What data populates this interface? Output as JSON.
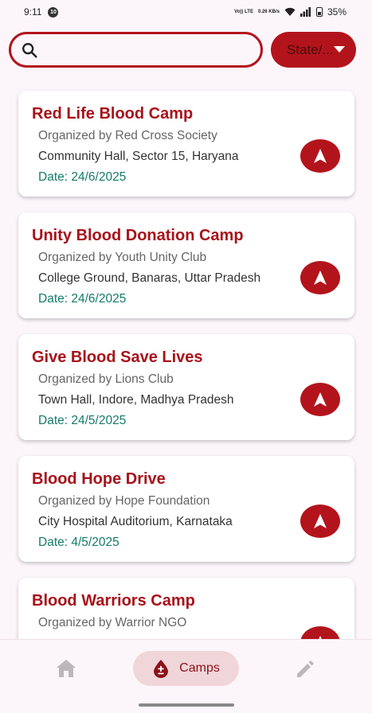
{
  "status": {
    "time": "9:11",
    "network": "Vo)) LTE",
    "speed": "0.26 KB/s",
    "battery": "35%"
  },
  "search": {
    "placeholder": "",
    "value": ""
  },
  "filter": {
    "label": "State/..."
  },
  "camps": [
    {
      "title": "Red Life Blood Camp",
      "organizer": "Organized by Red Cross Society",
      "location": "Community Hall, Sector 15, Haryana",
      "date": "Date: 24/6/2025"
    },
    {
      "title": "Unity Blood Donation Camp",
      "organizer": "Organized by Youth Unity Club",
      "location": "College Ground, Banaras, Uttar Pradesh",
      "date": "Date: 24/6/2025"
    },
    {
      "title": "Give Blood Save Lives",
      "organizer": "Organized by Lions Club",
      "location": "Town Hall, Indore, Madhya Pradesh",
      "date": "Date: 24/5/2025"
    },
    {
      "title": "Blood Hope Drive",
      "organizer": "Organized by Hope Foundation",
      "location": "City Hospital Auditorium, Karnataka",
      "date": "Date: 4/5/2025"
    },
    {
      "title": "Blood Warriors Camp",
      "organizer": "Organized by Warrior NGO",
      "location": "",
      "date": ""
    }
  ],
  "bottom_nav": {
    "home_icon": "home-icon",
    "camps_label": "Camps",
    "camps_icon": "blood-drop-icon",
    "edit_icon": "pencil-icon"
  },
  "colors": {
    "primary": "#b3141c",
    "title": "#a8121a",
    "date": "#147a6b",
    "background": "#fcf6fb",
    "active_pill": "#f0d6d9"
  }
}
